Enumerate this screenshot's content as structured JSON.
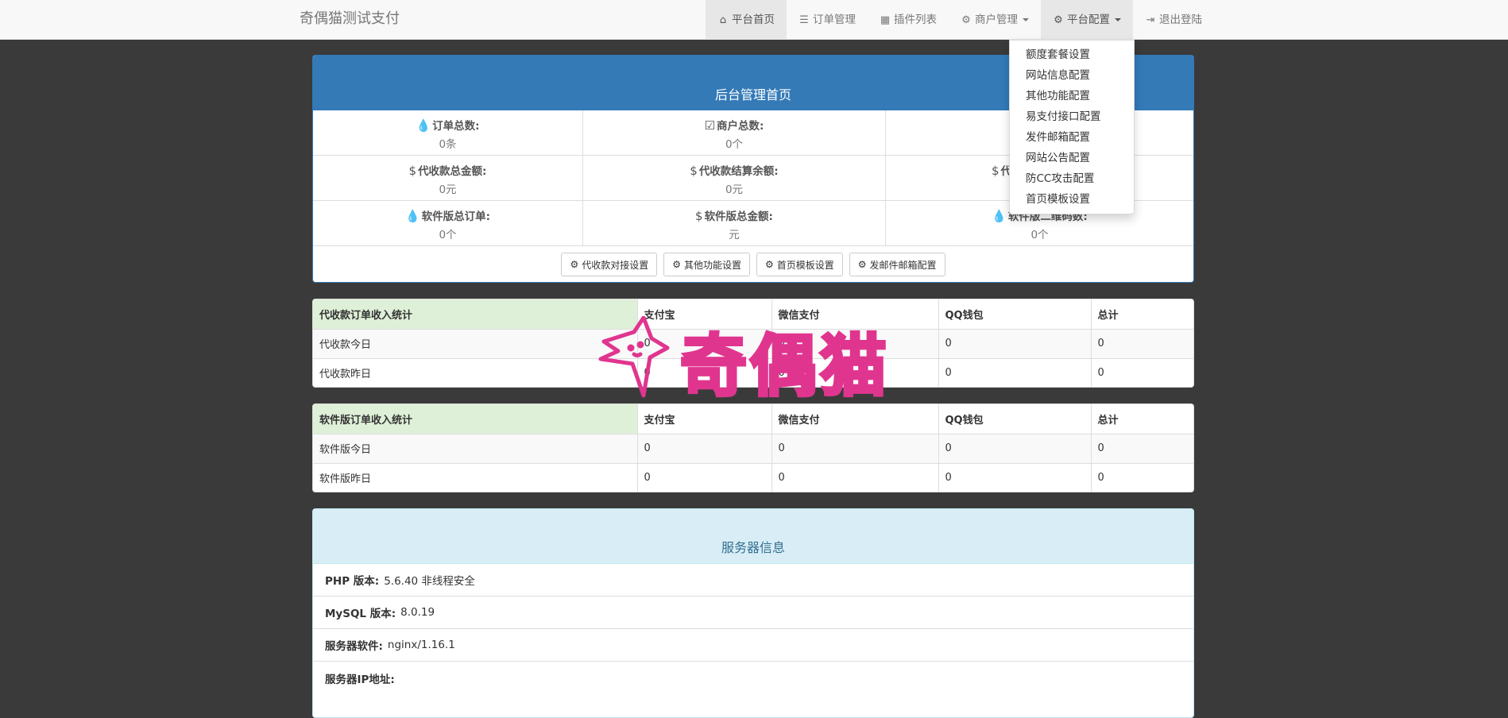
{
  "brand": "奇偶猫测试支付",
  "nav": [
    {
      "icon": "home-icon",
      "glyph": "⌂",
      "label": "平台首页",
      "caret": false
    },
    {
      "icon": "list-icon",
      "glyph": "☰",
      "label": "订单管理",
      "caret": false
    },
    {
      "icon": "grid-icon",
      "glyph": "▦",
      "label": "插件列表",
      "caret": false
    },
    {
      "icon": "gear-icon",
      "glyph": "⚙",
      "label": "商户管理",
      "caret": true
    },
    {
      "icon": "gear-icon",
      "glyph": "⚙",
      "label": "平台配置",
      "caret": true
    },
    {
      "icon": "logout-icon",
      "glyph": "⇥",
      "label": "退出登陆",
      "caret": false
    }
  ],
  "dropdown": [
    "额度套餐设置",
    "网站信息配置",
    "其他功能配置",
    "易支付接口配置",
    "发件邮箱配置",
    "网站公告配置",
    "防CC攻击配置",
    "首页模板设置"
  ],
  "overview": {
    "title": "后台管理首页",
    "stats": [
      {
        "icon": "drop-icon",
        "glyph": "💧",
        "label": "订单总数:",
        "value": "0条"
      },
      {
        "icon": "check-square-icon",
        "glyph": "☑",
        "label": "商户总数:",
        "value": "0个"
      },
      {
        "icon": "hidden-icon",
        "glyph": "",
        "label": "",
        "value": ""
      },
      {
        "icon": "dollar-icon",
        "glyph": "$",
        "label": "代收款总金额:",
        "value": "0元"
      },
      {
        "icon": "dollar-icon",
        "glyph": "$",
        "label": "代收款结算余额:",
        "value": "0元"
      },
      {
        "icon": "dollar-icon",
        "glyph": "$",
        "label": "代",
        "value": ""
      },
      {
        "icon": "drop-icon",
        "glyph": "💧",
        "label": "软件版总订单:",
        "value": "0个"
      },
      {
        "icon": "dollar-icon",
        "glyph": "$",
        "label": "软件版总金额:",
        "value": "元"
      },
      {
        "icon": "drop-icon",
        "glyph": "💧",
        "label": "软件版二维码数:",
        "value": "0个"
      }
    ],
    "buttons": [
      "代收款对接设置",
      "其他功能设置",
      "首页模板设置",
      "发邮件邮箱配置"
    ]
  },
  "table1": {
    "headers": [
      "代收款订单收入统计",
      "支付宝",
      "微信支付",
      "QQ钱包",
      "总计"
    ],
    "rows": [
      [
        "代收款今日",
        "0",
        "0",
        "0",
        "0"
      ],
      [
        "代收款昨日",
        "0",
        "0",
        "0",
        "0"
      ]
    ]
  },
  "table2": {
    "headers": [
      "软件版订单收入统计",
      "支付宝",
      "微信支付",
      "QQ钱包",
      "总计"
    ],
    "rows": [
      [
        "软件版今日",
        "0",
        "0",
        "0",
        "0"
      ],
      [
        "软件版昨日",
        "0",
        "0",
        "0",
        "0"
      ]
    ]
  },
  "server": {
    "title": "服务器信息",
    "rows": [
      {
        "label": "PHP 版本:",
        "value": "5.6.40 非线程安全"
      },
      {
        "label": "MySQL 版本:",
        "value": "8.0.19"
      },
      {
        "label": "服务器软件:",
        "value": "nginx/1.16.1"
      },
      {
        "label": "服务器IP地址:",
        "value": ""
      }
    ]
  },
  "watermark": {
    "text": "奇偶猫",
    "color": "#e0358f"
  }
}
